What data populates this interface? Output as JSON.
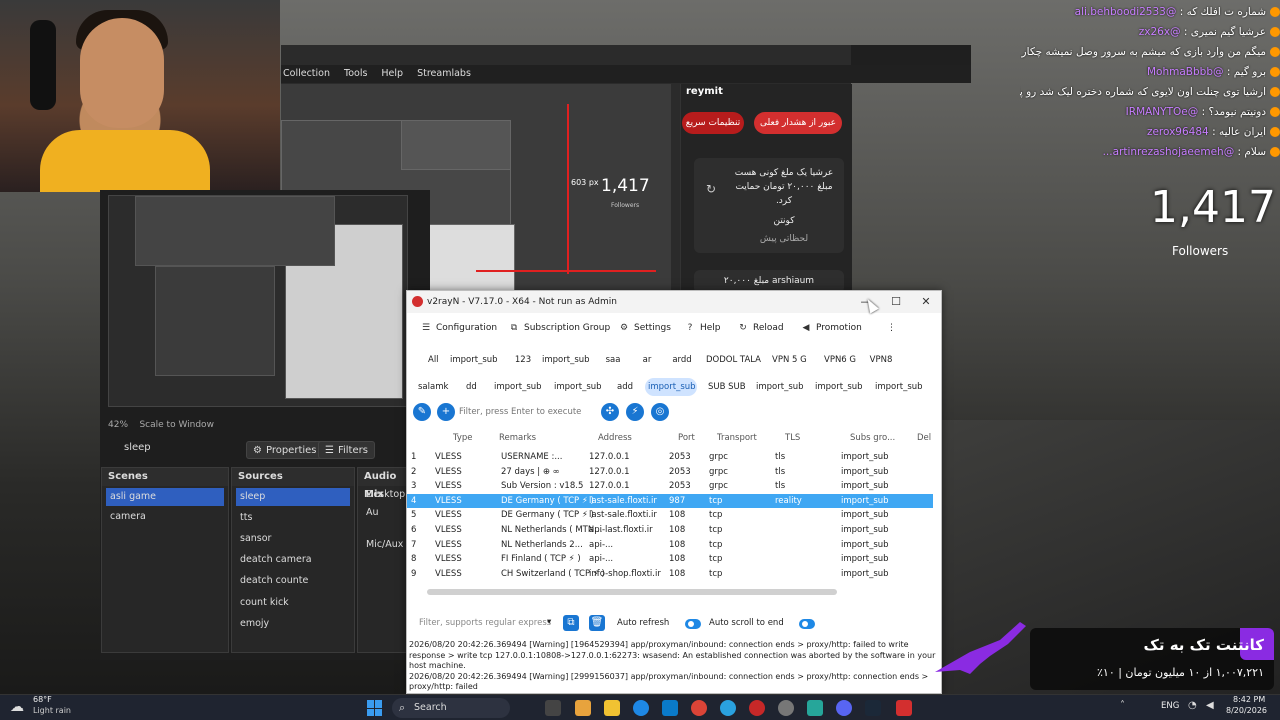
{
  "chat": [
    {
      "user": "@ali.behboodi2533",
      "text": "شماره ت افلك كه :"
    },
    {
      "user": "@zx26x",
      "text": "عرشيا گيم نميرى :"
    },
    {
      "user": "@Tahan891",
      "text": "ميگم من وارد بازی که ميشم به سرور وصل نميشه چكار كنم"
    },
    {
      "user": "@MohmaBbbb",
      "text": "برو گيم :"
    },
    {
      "user": "@Reza45-RSR",
      "text": "ارشيا توی چنلت اون لايوی که شماره دختره ليک شد رو پاک کن"
    },
    {
      "user": "@IRMANYTOe",
      "text": "دونيتم نيومد؟ :"
    },
    {
      "user": "zerox96484",
      "text": "ايران عاليه :"
    },
    {
      "user": "@artinrezashojaeemeh...",
      "text": "سلام :"
    }
  ],
  "followers": {
    "count": "1,417",
    "label": "Followers"
  },
  "browser": {
    "menu": [
      "Collection",
      "Tools",
      "Help",
      "Streamlabs"
    ],
    "preview_count": "1,417",
    "preview_px": "603 px",
    "preview_followers": "Followers"
  },
  "reymit": {
    "title": "reymit",
    "btn_emergency": "عبور از هشدار فعلی",
    "btn_quick": "تنظیمات سریع",
    "card_text": "عرشيا يک ملغ کونی هست مبلغ ۲۰,۰۰۰ تومان حمایت کرد.",
    "card_sub": "کونتن",
    "card_time": "لحظاتی پیش",
    "card2_text": "arshiaum مبلغ ۲۰,۰۰۰"
  },
  "obs": {
    "zoom": "42%",
    "scale": "Scale to Window",
    "scene_name": "sleep",
    "properties": "Properties",
    "filters": "Filters",
    "scenes_title": "Scenes",
    "sources_title": "Sources",
    "audio_title": "Audio Mix",
    "scenes": [
      "asli game",
      "camera"
    ],
    "sources": [
      "sleep",
      "tts",
      "sansor",
      "deatch camera",
      "deatch counte",
      "count kick",
      "emojy"
    ],
    "audio": [
      "Desktop Au",
      "Mic/Aux"
    ]
  },
  "v2": {
    "title": "v2rayN - V7.17.0 - X64 - Not run as Admin",
    "toolbar": [
      "Configuration",
      "Subscription Group",
      "Settings",
      "Help",
      "Reload",
      "Promotion"
    ],
    "chips_row1": [
      "All",
      "import_sub",
      "123",
      "import_sub",
      "saa",
      "ar",
      "ardd",
      "DODOL TALA",
      "VPN 5 G",
      "VPN6 G",
      "VPN8"
    ],
    "chips_row2": [
      "salamk",
      "dd",
      "import_sub",
      "import_sub",
      "add",
      "import_sub",
      "SUB SUB",
      "import_sub",
      "import_sub",
      "import_sub"
    ],
    "filter_placeholder": "Filter, press Enter to execute",
    "columns": [
      "Type",
      "Remarks",
      "Address",
      "Port",
      "Transport",
      "TLS",
      "Subs gro...",
      "Del"
    ],
    "rows": [
      [
        "1",
        "VLESS",
        "USERNAME :...",
        "127.0.0.1",
        "2053",
        "grpc",
        "tls",
        "import_sub"
      ],
      [
        "2",
        "VLESS",
        "27 days | ⊕ ∞",
        "127.0.0.1",
        "2053",
        "grpc",
        "tls",
        "import_sub"
      ],
      [
        "3",
        "VLESS",
        "Sub Version : v18.5",
        "127.0.0.1",
        "2053",
        "grpc",
        "tls",
        "import_sub"
      ],
      [
        "4",
        "VLESS",
        "DE Germany ( TCP ⚡ )",
        "last-sale.floxti.ir",
        "987",
        "tcp",
        "reality",
        "import_sub"
      ],
      [
        "5",
        "VLESS",
        "DE Germany ( TCP ⚡ )",
        "last-sale.floxti.ir",
        "108",
        "tcp",
        "",
        "import_sub"
      ],
      [
        "6",
        "VLESS",
        "NL Netherlands ( MTN...",
        "api-last.floxti.ir",
        "108",
        "tcp",
        "",
        "import_sub"
      ],
      [
        "7",
        "VLESS",
        "NL Netherlands 2...",
        "api-...",
        "108",
        "tcp",
        "",
        "import_sub"
      ],
      [
        "8",
        "VLESS",
        "FI Finland ( TCP ⚡ )",
        "api-...",
        "108",
        "tcp",
        "",
        "import_sub"
      ],
      [
        "9",
        "VLESS",
        "CH Switzerland ( TCP ⚡ )",
        "info-shop.floxti.ir",
        "108",
        "tcp",
        "",
        "import_sub"
      ]
    ],
    "log_filter_placeholder": "Filter, supports regular express",
    "auto_refresh": "Auto refresh",
    "auto_scroll": "Auto scroll to end",
    "log": [
      "2026/08/20 20:42:26.369494 [Warning] [1964529394] app/proxyman/inbound: connection ends > proxy/http: failed to write response > write tcp 127.0.0.1:10808->127.0.0.1:62273: wsasend: An established connection was aborted by the software in your host machine.",
      "2026/08/20 20:42:26.369494 [Warning] [2999156037] app/proxyman/inbound: connection ends > proxy/http: connection ends > proxy/http: failed"
    ]
  },
  "ad": {
    "title": "کانتنت تک به تک",
    "sub": "۱,۰۰۷,۲۲۱ از ۱۰ ميليون تومان | ۱۰٪"
  },
  "taskbar": {
    "temp": "68°F",
    "weather": "Light rain",
    "search": "Search",
    "lang": "ENG",
    "time": "8:42 PM",
    "date": "8/20/2026"
  },
  "colors": {
    "accent": "#1976d2",
    "selection": "#3fa7f3",
    "reymit_red": "#d32f2f",
    "obs_select": "#2f5fbf"
  }
}
